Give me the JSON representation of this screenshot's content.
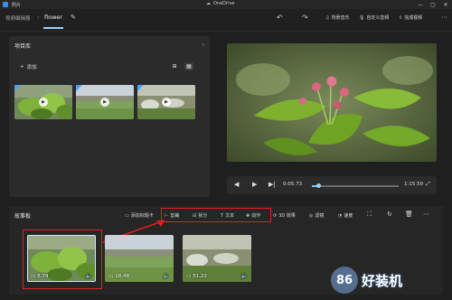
{
  "titlebar": {
    "app_name": "照片",
    "onedrive": "OneDrive",
    "min": "—",
    "max": "▢",
    "close": "✕"
  },
  "toolbar": {
    "breadcrumb_parent": "视频编辑器",
    "breadcrumb_sep": "›",
    "project_name": "flower",
    "buttons": [
      {
        "label": "背景音乐",
        "icon": "♫"
      },
      {
        "label": "自定义音频",
        "icon": "🎙"
      },
      {
        "label": "完成视频",
        "icon": "⇪"
      }
    ]
  },
  "library": {
    "title": "项目库",
    "add_label": "添加",
    "thumbs": [
      {
        "name": "thumb-leaves",
        "selected": true
      },
      {
        "name": "thumb-field",
        "selected": true
      },
      {
        "name": "thumb-garden",
        "selected": true
      }
    ]
  },
  "player": {
    "current_time": "0:05.73",
    "total_time": "1:15.50",
    "progress": 0.073
  },
  "storyboard": {
    "title": "故事板",
    "add_title_card": "添加标题卡",
    "tools": [
      "剪裁",
      "拆分",
      "文本",
      "动作"
    ],
    "fx_3d": "3D 效果",
    "filters": "滤镜",
    "speed": "速度",
    "clips": [
      {
        "duration": "5.74",
        "selected": true
      },
      {
        "duration": "18.48",
        "selected": false
      },
      {
        "duration": "51.22",
        "selected": false
      }
    ]
  },
  "watermark": {
    "badge": "86",
    "text": "好装机"
  },
  "colors": {
    "accent": "#9bd0ff",
    "highlight": "#e02020",
    "panel": "#2b2b2b"
  }
}
